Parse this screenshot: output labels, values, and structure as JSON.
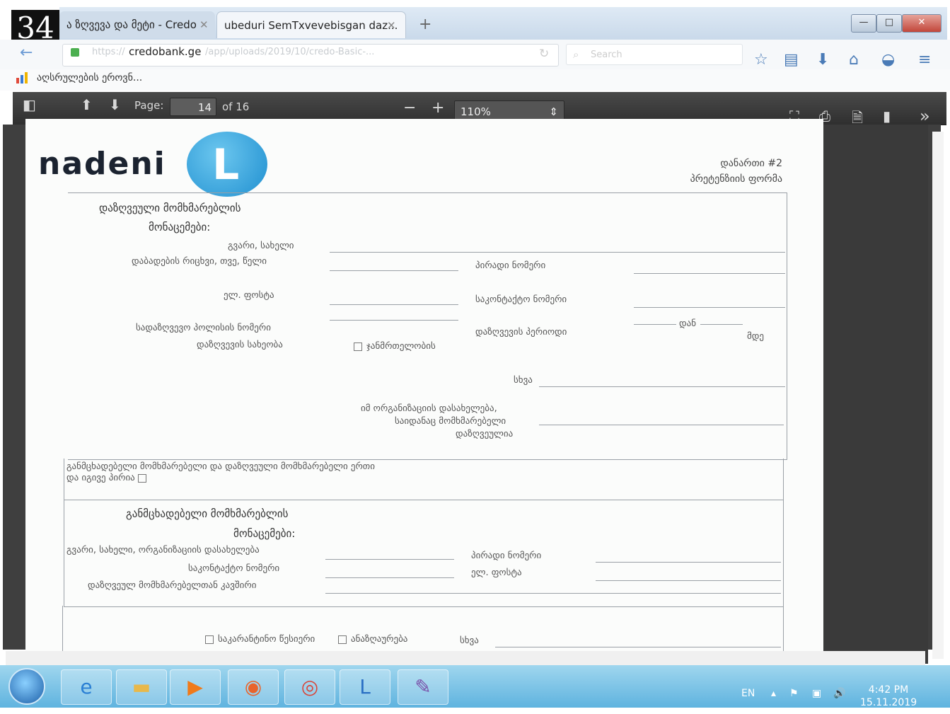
{
  "badge": {
    "number": "34"
  },
  "browser": {
    "tabs": [
      {
        "label": "ა ზღვევა და მეტი - Credo"
      },
      {
        "label": "ubeduri SemTxvevebisgan daz..."
      }
    ],
    "new_tab": "+",
    "url_prefix": "https://",
    "url_host": "credobank.ge",
    "url_path": "/app/uploads/2019/10/credo-Basic-...",
    "search_placeholder": "Search",
    "bookmark_label": "აღსრულების ეროვნ..."
  },
  "pdf_toolbar": {
    "page_label": "Page:",
    "page_value": "14",
    "of_total": "of 16",
    "zoom": "110%"
  },
  "document": {
    "logo_text": "nadeni",
    "logo_letter": "L",
    "appendix": "დანართი #2",
    "form_name": "პრეტენზიის ფორმა",
    "section_insured": "დაზღვეული მომხმარებლის",
    "section_insured2": "მონაცემები:",
    "name_label": "გვარი, სახელი",
    "dob_label": "დაბადების რიცხვი, თვე, წელი",
    "id_label": "პირადი ნომერი",
    "email_label": "ელ. ფოსტა",
    "phone_label": "საკონტაქტო ნომერი",
    "policy_label": "სადაზღვევო პოლისის ნომერი",
    "type_label": "დაზღვევის სახეობა",
    "accident_label": "ჯანმრთელობის",
    "period_label": "დაზღვევის პერიოდი",
    "period_from": "დან",
    "period_to": "მდე",
    "other_label": "სხვა",
    "org_label_1": "იმ ორგანიზაციის დასახელება,",
    "org_label_2": "საიდანაც მომხმარებელი",
    "org_label_3": "დაზღვეულია",
    "same_person_1": "განმცხადებელი მომხმარებელი და დაზღვეული მომხმარებელი ერთი",
    "same_person_2": "და იგივე პირია",
    "section_applicant": "განმცხადებელი მომხმარებლის",
    "section_applicant2": "მონაცემები:",
    "app_name_label": "გვარი, სახელი, ორგანიზაციის დასახელება",
    "app_id_label": "პირადი ნომერი",
    "app_phone_label": "საკონტაქტო ნომერი",
    "app_email_label": "ელ. ფოსტა",
    "relation_label": "დაზღვეულ მომხმარებელთან კავშირი",
    "bottom_opt1": "საკარანტინო წესიერი",
    "bottom_opt2": "ანაზღაურება",
    "bottom_other": "სხვა"
  },
  "taskbar": {
    "lang": "EN",
    "time": "4:42 PM",
    "date": "15.11.2019"
  }
}
